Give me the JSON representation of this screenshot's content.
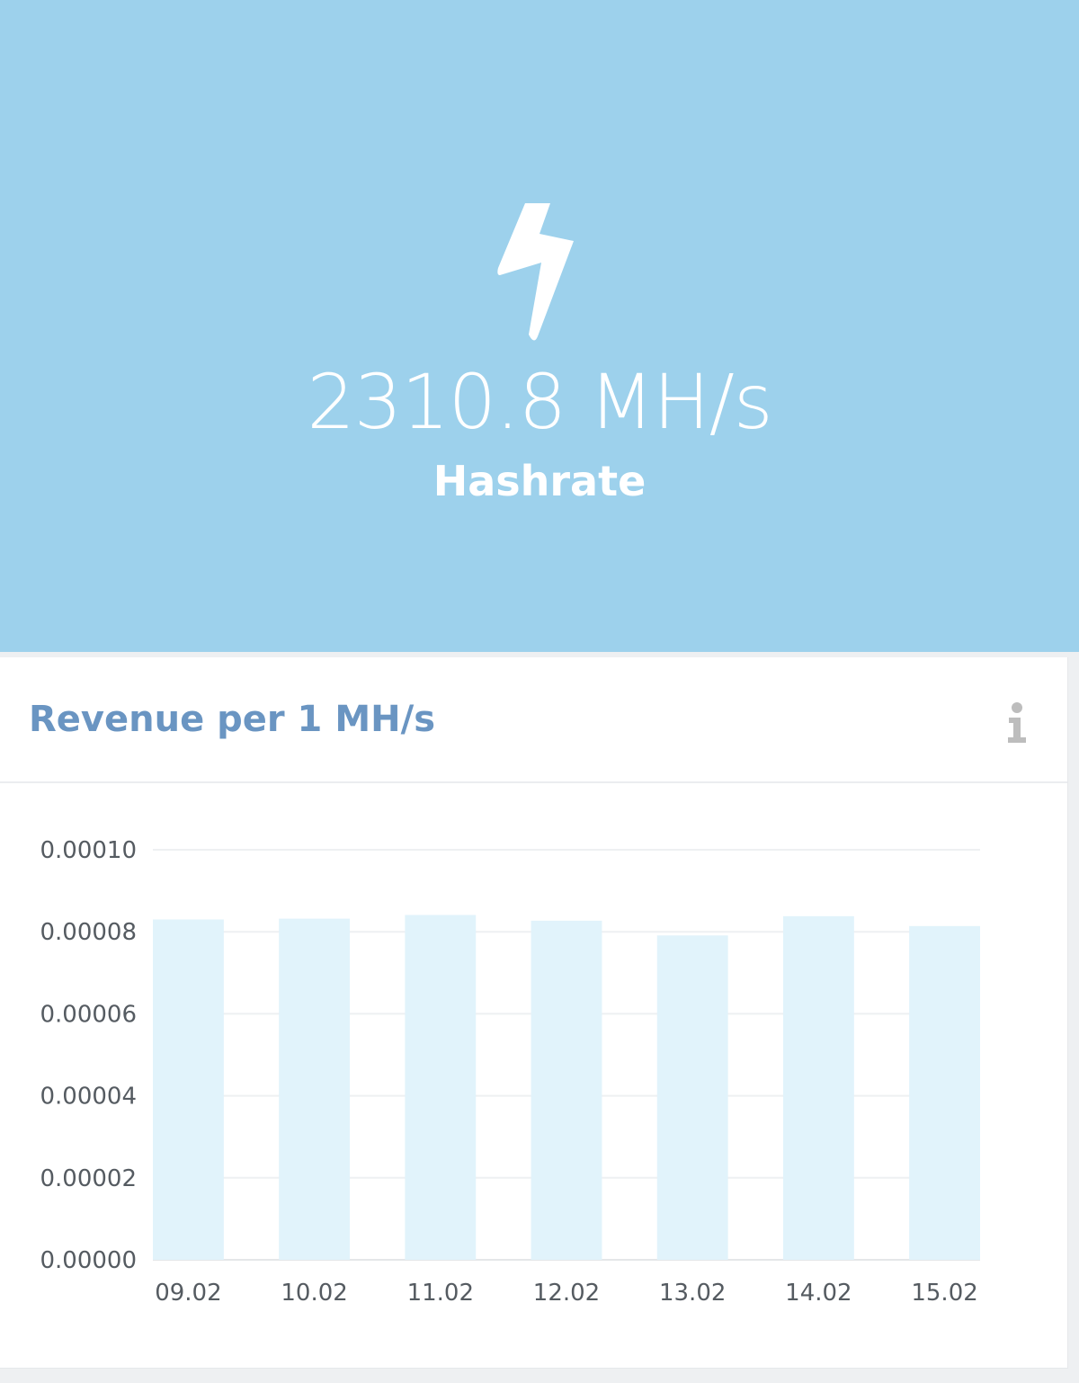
{
  "hero": {
    "icon": "lightning-bolt-icon",
    "value": "2310.8 MH/s",
    "label": "Hashrate",
    "background": "#9dd1ec"
  },
  "card": {
    "title": "Revenue per 1 MH/s",
    "info_icon": "info-icon"
  },
  "chart_data": {
    "type": "bar",
    "categories": [
      "09.02",
      "10.02",
      "11.02",
      "12.02",
      "13.02",
      "14.02",
      "15.02"
    ],
    "values": [
      8.3e-05,
      8.32e-05,
      8.41e-05,
      8.27e-05,
      7.91e-05,
      8.38e-05,
      8.14e-05
    ],
    "ylim": [
      0,
      0.0001
    ],
    "yticks": [
      "0.00000",
      "0.00002",
      "0.00004",
      "0.00006",
      "0.00008",
      "0.00010"
    ],
    "bar_color": "#e1f3fb",
    "grid": true,
    "legend": "none"
  }
}
